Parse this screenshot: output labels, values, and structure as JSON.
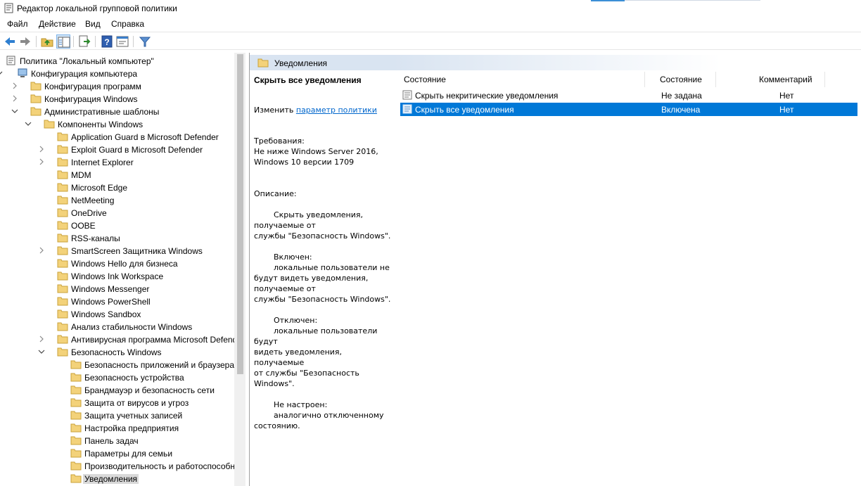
{
  "window": {
    "title": "Редактор локальной групповой политики"
  },
  "menu": [
    "Файл",
    "Действие",
    "Вид",
    "Справка"
  ],
  "toolbar": {
    "buttons": [
      "back-icon",
      "forward-icon",
      "up-folder-icon",
      "show-hide-tree-icon",
      "export-list-icon",
      "help-icon",
      "properties-icon",
      "filter-icon"
    ]
  },
  "tree": {
    "items": [
      {
        "label": "Политика \"Локальный компьютер\"",
        "icon": "computer-policy-icon"
      },
      {
        "label": "Конфигурация компьютера",
        "icon": "computer-icon"
      },
      {
        "label": "Конфигурация программ",
        "icon": "folder-icon"
      },
      {
        "label": "Конфигурация Windows",
        "icon": "folder-icon"
      },
      {
        "label": "Административные шаблоны",
        "icon": "folder-icon"
      },
      {
        "label": "Компоненты Windows",
        "icon": "folder-icon"
      },
      {
        "label": "Application Guard в Microsoft Defender",
        "icon": "folder-icon"
      },
      {
        "label": "Exploit Guard в Microsoft Defender",
        "icon": "folder-icon"
      },
      {
        "label": "Internet Explorer",
        "icon": "folder-icon"
      },
      {
        "label": "MDM",
        "icon": "folder-icon"
      },
      {
        "label": "Microsoft Edge",
        "icon": "folder-icon"
      },
      {
        "label": "NetMeeting",
        "icon": "folder-icon"
      },
      {
        "label": "OneDrive",
        "icon": "folder-icon"
      },
      {
        "label": "OOBE",
        "icon": "folder-icon"
      },
      {
        "label": "RSS-каналы",
        "icon": "folder-icon"
      },
      {
        "label": "SmartScreen Защитника Windows",
        "icon": "folder-icon"
      },
      {
        "label": "Windows Hello для бизнеса",
        "icon": "folder-icon"
      },
      {
        "label": "Windows Ink Workspace",
        "icon": "folder-icon"
      },
      {
        "label": "Windows Messenger",
        "icon": "folder-icon"
      },
      {
        "label": "Windows PowerShell",
        "icon": "folder-icon"
      },
      {
        "label": "Windows Sandbox",
        "icon": "folder-icon"
      },
      {
        "label": "Анализ стабильности Windows",
        "icon": "folder-icon"
      },
      {
        "label": "Антивирусная программа Microsoft Defender",
        "icon": "folder-icon"
      },
      {
        "label": "Безопасность Windows",
        "icon": "folder-icon"
      },
      {
        "label": "Безопасность приложений и браузера",
        "icon": "folder-icon"
      },
      {
        "label": "Безопасность устройства",
        "icon": "folder-icon"
      },
      {
        "label": "Брандмауэр и безопасность сети",
        "icon": "folder-icon"
      },
      {
        "label": "Защита от вирусов и угроз",
        "icon": "folder-icon"
      },
      {
        "label": "Защита учетных записей",
        "icon": "folder-icon"
      },
      {
        "label": "Настройка предприятия",
        "icon": "folder-icon"
      },
      {
        "label": "Панель задач",
        "icon": "folder-icon"
      },
      {
        "label": "Параметры для семьи",
        "icon": "folder-icon"
      },
      {
        "label": "Производительность и работоспособность устройства",
        "icon": "folder-icon"
      },
      {
        "label": "Уведомления",
        "icon": "folder-icon"
      }
    ]
  },
  "content": {
    "header_title": "Уведомления",
    "description": {
      "policy_title": "Скрыть все уведомления",
      "edit_prefix": "Изменить ",
      "edit_link": "параметр политики",
      "requirements": "Требования:\nНе ниже Windows Server 2016,\nWindows 10 версии 1709",
      "description_body": "Описание:\n\n        Скрыть уведомления,\nполучаемые от\nслужбы \"Безопасность Windows\".\n\n        Включен:\n        локальные пользователи не\nбудут видеть уведомления,\nполучаемые от\nслужбы \"Безопасность Windows\".\n\n        Отключен:\n        локальные пользователи будут\nвидеть уведомления, получаемые\nот службы \"Безопасность Windows\".\n\n        Не настроен:\n        аналогично отключенному\nсостоянию."
    },
    "columns": [
      "Состояние",
      "Состояние",
      "Комментарий"
    ],
    "rows": [
      {
        "name": "Скрыть некритические уведомления",
        "state": "Не задана",
        "comment": "Нет",
        "selected": false
      },
      {
        "name": "Скрыть все уведомления",
        "state": "Включена",
        "comment": "Нет",
        "selected": true
      }
    ]
  },
  "colors": {
    "selection": "#0078d7",
    "header_band": "#d9e4f1",
    "link": "#0066cc"
  }
}
